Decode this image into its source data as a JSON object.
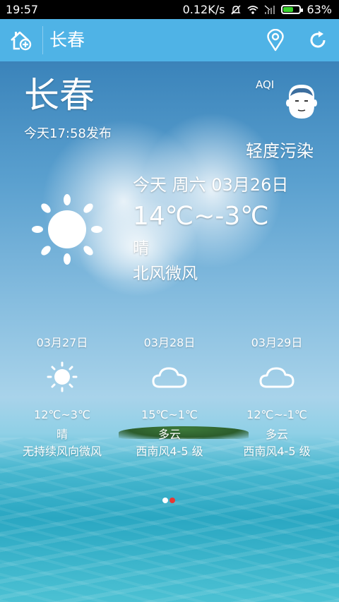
{
  "status_bar": {
    "time": "19:57",
    "network_speed": "0.12K/s",
    "battery_percent": "63%",
    "battery_level": 0.63,
    "battery_color": "#39d12e",
    "icons": [
      "mute-icon",
      "wifi-icon",
      "signal-icon",
      "battery-icon"
    ]
  },
  "header": {
    "title": "长春",
    "background_color": "#4fb3e6",
    "left_icon": "add-home-icon",
    "right_icons": [
      "location-pin-icon",
      "refresh-icon"
    ]
  },
  "current": {
    "city": "长春",
    "published": "今天17:58发布",
    "aqi_label": "AQI",
    "aqi_level": "轻度污染",
    "aqi_icon": "face-mask-avatar-icon",
    "date": "今天 周六 03月26日",
    "temperature": "14℃~-3℃",
    "condition": "晴",
    "wind": "北风微风",
    "icon": "sun-icon"
  },
  "forecast": [
    {
      "date": "03月27日",
      "icon": "sun-icon",
      "temperature": "12℃~3℃",
      "condition": "晴",
      "wind": "无持续风向微风"
    },
    {
      "date": "03月28日",
      "icon": "cloud-icon",
      "temperature": "15℃~1℃",
      "condition": "多云",
      "wind": "西南风4-5 级"
    },
    {
      "date": "03月29日",
      "icon": "cloud-icon",
      "temperature": "12℃~-1℃",
      "condition": "多云",
      "wind": "西南风4-5 级"
    }
  ],
  "pager": {
    "pages": 2,
    "active": 2,
    "active_color": "#e53935",
    "inactive_color": "#ffffff"
  }
}
